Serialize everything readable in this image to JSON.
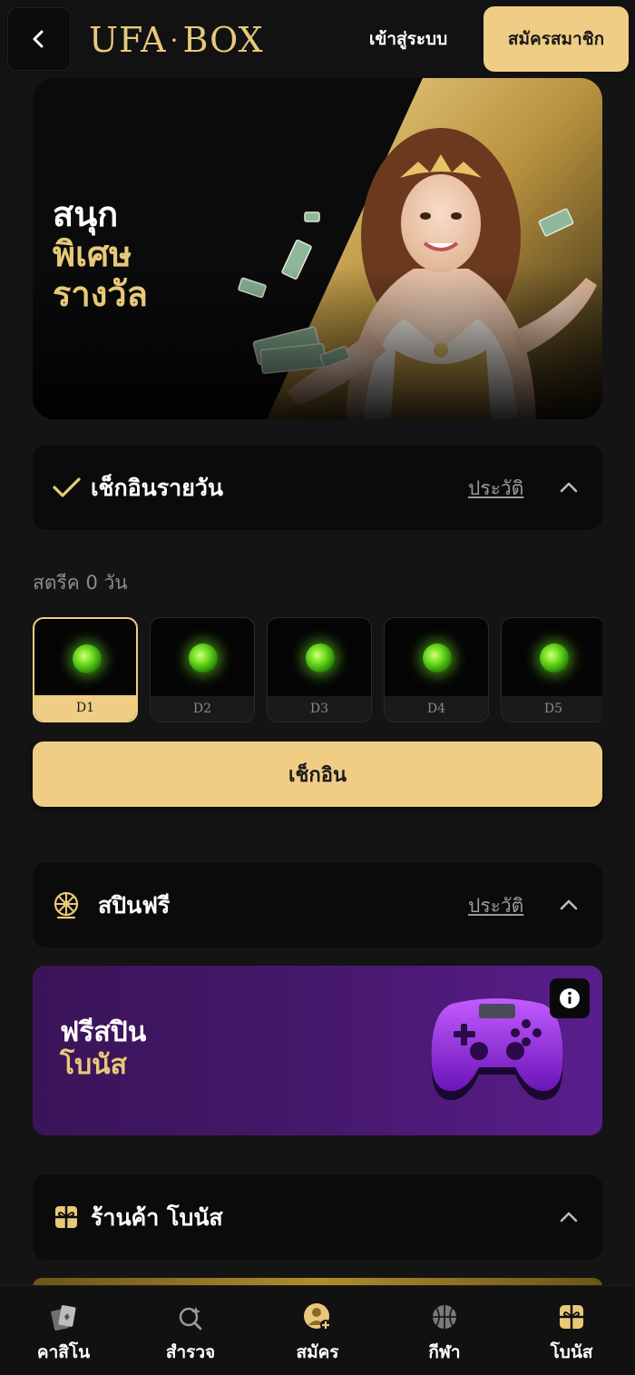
{
  "header": {
    "logo": {
      "left": "UFA",
      "dot": "·",
      "right": "BOX"
    },
    "login_label": "เข้าสู่ระบบ",
    "register_label": "สมัครสมาชิก"
  },
  "hero": {
    "line1": "สนุก",
    "line2": "พิเศษ",
    "line3": "รางวัล"
  },
  "checkin_section": {
    "title": "เช็กอินรายวัน",
    "history_label": "ประวัติ",
    "streak_label": "สตรีค 0 วัน",
    "days": [
      {
        "label": "D1",
        "active": true
      },
      {
        "label": "D2",
        "active": false
      },
      {
        "label": "D3",
        "active": false
      },
      {
        "label": "D4",
        "active": false
      },
      {
        "label": "D5",
        "active": false
      }
    ],
    "button_label": "เช็กอิน"
  },
  "spin_section": {
    "title": "สปินฟรี",
    "history_label": "ประวัติ",
    "banner_line1": "ฟรีสปิน",
    "banner_line2": "โบนัส"
  },
  "shop_section": {
    "title": "ร้านค้า โบนัส"
  },
  "bottom_nav": [
    {
      "label": "คาสิโน",
      "icon": "cards-icon"
    },
    {
      "label": "สำรวจ",
      "icon": "explore-icon"
    },
    {
      "label": "สมัคร",
      "icon": "add-user-icon"
    },
    {
      "label": "กีฬา",
      "icon": "basketball-icon"
    },
    {
      "label": "โบนัส",
      "icon": "gift-icon"
    }
  ],
  "colors": {
    "accent": "#efcd85",
    "gold_text": "#e8c97a",
    "background": "#141414",
    "card": "#0b0b0b",
    "purple": "#45186b"
  }
}
